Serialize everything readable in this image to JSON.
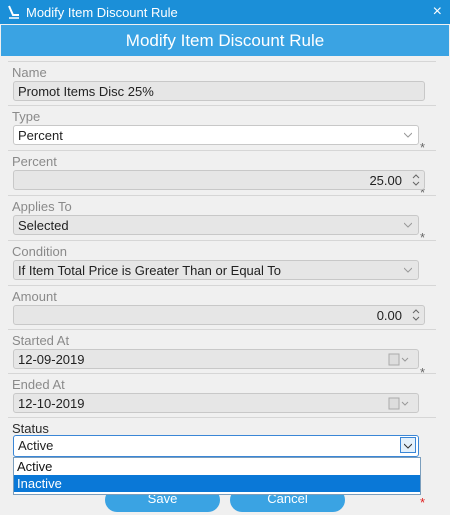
{
  "window": {
    "title": "Modify Item Discount Rule",
    "close_glyph": "×"
  },
  "header": {
    "title": "Modify Item Discount Rule"
  },
  "form": {
    "name": {
      "label": "Name",
      "value": "Promot Items Disc 25%",
      "required": "*"
    },
    "type": {
      "label": "Type",
      "value": "Percent",
      "required": "*"
    },
    "percent": {
      "label": "Percent",
      "value": "25.00",
      "required": "*"
    },
    "applies_to": {
      "label": "Applies To",
      "value": "Selected"
    },
    "condition": {
      "label": "Condition",
      "value": "If Item Total Price is Greater Than or Equal To"
    },
    "amount": {
      "label": "Amount",
      "value": "0.00",
      "required": "*"
    },
    "started_at": {
      "label": "Started At",
      "value": "12-09-2019"
    },
    "ended_at": {
      "label": "Ended At",
      "value": "12-10-2019"
    },
    "status": {
      "label": "Status",
      "value": "Active",
      "required": "*",
      "options": [
        "Active",
        "Inactive"
      ],
      "highlighted_option": "Inactive"
    }
  },
  "buttons": {
    "save": "Save",
    "cancel": "Cancel"
  },
  "colors": {
    "titlebar": "#1b8fd8",
    "header": "#3aa3e3",
    "selection": "#0a78d7",
    "required_active": "#e02020"
  }
}
